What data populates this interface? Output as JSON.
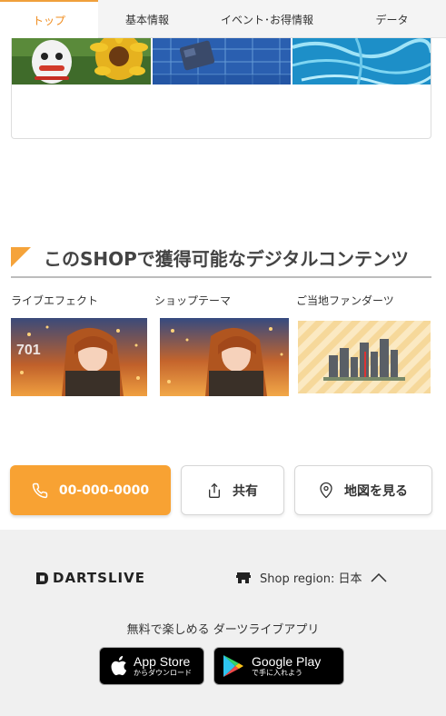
{
  "tabs": [
    {
      "label": "トップ",
      "active": true
    },
    {
      "label": "基本情報",
      "active": false
    },
    {
      "label": "イベント･お得情報",
      "active": false
    },
    {
      "label": "データ",
      "active": false
    }
  ],
  "section": {
    "title": "このSHOPで獲得可能なデジタルコンテンツ",
    "accent_color": "#f5a33a"
  },
  "contents": [
    {
      "label": "ライブエフェクト",
      "overlay_text": "701"
    },
    {
      "label": "ショップテーマ"
    },
    {
      "label": "ご当地ファンダーツ"
    }
  ],
  "actions": {
    "phone": {
      "label": "00-000-0000",
      "icon": "phone-icon",
      "color": "#f8a233"
    },
    "share": {
      "label": "共有",
      "icon": "share-icon"
    },
    "map": {
      "label": "地図を見る",
      "icon": "map-pin-icon"
    }
  },
  "footer": {
    "logo": "DARTSLIVE",
    "region": "Shop region: 日本",
    "app_caption": "無料で楽しめる ダーツライブアプリ",
    "app_store": {
      "main": "App Store",
      "sub": "からダウンロード"
    },
    "google_play": {
      "main": "Google Play",
      "sub": "で手に入れよう"
    }
  }
}
